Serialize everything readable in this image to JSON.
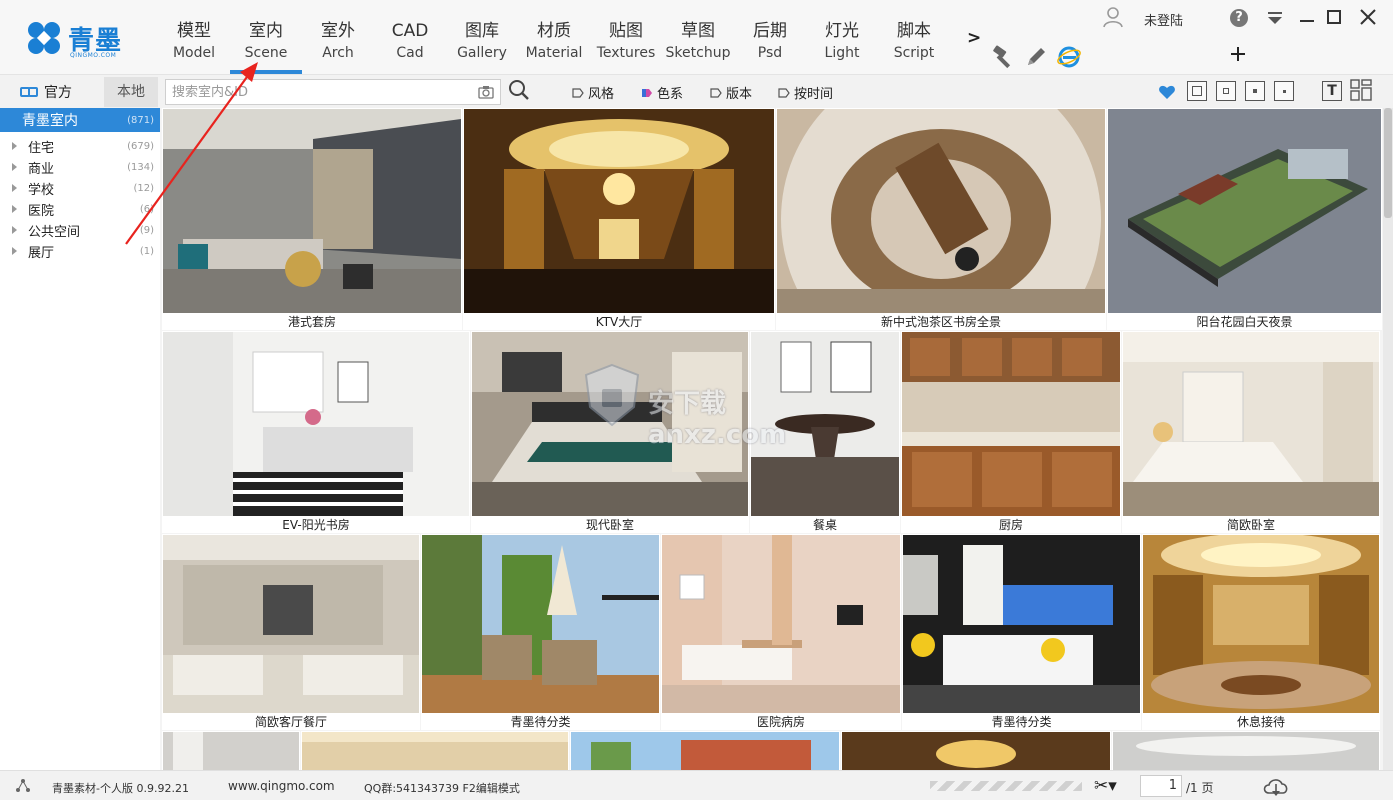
{
  "app": {
    "logo_name": "青墨",
    "logo_domain": "QINGMO.COM"
  },
  "nav": {
    "tabs": [
      {
        "cn": "模型",
        "en": "Model"
      },
      {
        "cn": "室内",
        "en": "Scene"
      },
      {
        "cn": "室外",
        "en": "Arch"
      },
      {
        "cn": "CAD",
        "en": "Cad"
      },
      {
        "cn": "图库",
        "en": "Gallery"
      },
      {
        "cn": "材质",
        "en": "Material"
      },
      {
        "cn": "贴图",
        "en": "Textures"
      },
      {
        "cn": "草图",
        "en": "Sketchup"
      },
      {
        "cn": "后期",
        "en": "Psd"
      },
      {
        "cn": "灯光",
        "en": "Light"
      },
      {
        "cn": "脚本",
        "en": "Script"
      }
    ],
    "active_tab": "室内",
    "more_label": ">"
  },
  "user": {
    "login_label": "未登陆",
    "help_label": "?"
  },
  "source_tabs": {
    "official": "官方",
    "local": "本地"
  },
  "search": {
    "placeholder": "搜索室内&ID"
  },
  "filters": {
    "style": "风格",
    "color": "色系",
    "version": "版本",
    "time": "按时间"
  },
  "view_controls": {
    "text_view_label": "T"
  },
  "sidebar": {
    "root": {
      "label": "青墨室内",
      "count": "(871)"
    },
    "items": [
      {
        "label": "住宅",
        "count": "(679)"
      },
      {
        "label": "商业",
        "count": "(134)"
      },
      {
        "label": "学校",
        "count": "(12)"
      },
      {
        "label": "医院",
        "count": "(6)"
      },
      {
        "label": "公共空间",
        "count": "(9)"
      },
      {
        "label": "展厅",
        "count": "(1)"
      }
    ]
  },
  "gallery": {
    "rows": [
      [
        {
          "caption": "港式套房"
        },
        {
          "caption": "KTV大厅"
        },
        {
          "caption": "新中式泡茶区书房全景"
        },
        {
          "caption": "阳台花园白天夜景"
        }
      ],
      [
        {
          "caption": "EV-阳光书房"
        },
        {
          "caption": "现代卧室"
        },
        {
          "caption": "餐桌"
        },
        {
          "caption": "厨房"
        },
        {
          "caption": "简欧卧室"
        }
      ],
      [
        {
          "caption": "简欧客厅餐厅"
        },
        {
          "caption": "青墨待分类"
        },
        {
          "caption": "医院病房"
        },
        {
          "caption": "青墨待分类"
        },
        {
          "caption": "休息接待"
        }
      ]
    ],
    "watermark": "安下载 anxz.com"
  },
  "status": {
    "version": "青墨素材-个人版 0.9.92.21",
    "site": "www.qingmo.com",
    "qq": "QQ群:541343739 F2编辑模式",
    "scissors_label": "✂▾",
    "page_current": "1",
    "page_total": "/1 页"
  }
}
